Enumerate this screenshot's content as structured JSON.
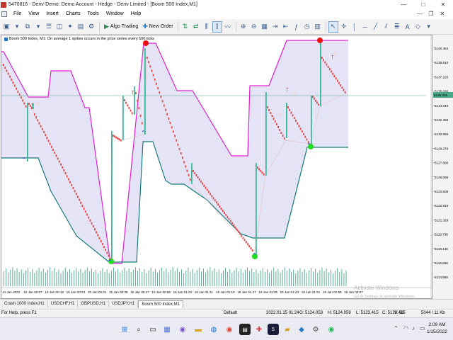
{
  "window": {
    "title": "5470816 - Deriv-Demo: Demo Account - Hedge - Deriv Limited - [Boom 500 Index,M1]",
    "controls": [
      "—",
      "□",
      "✕"
    ]
  },
  "menu": {
    "items": [
      "File",
      "View",
      "Insert",
      "Charts",
      "Tools",
      "Window",
      "Help"
    ],
    "mdi_controls": [
      "—",
      "❐",
      "✕"
    ]
  },
  "toolbar": {
    "algo_trading_label": "Algo Trading",
    "new_order_label": "New Order"
  },
  "chart": {
    "info_text": "Boom 500 Index, M1:  On average 1 spikes occurs in the price series every 500 ticks",
    "current_price_label": "5135.036",
    "price_labels": [
      "5140.484",
      "5138.810",
      "5137.220",
      "5135.036",
      "5134.048",
      "5132.458",
      "5130.868",
      "5129.278",
      "5127.690",
      "5126.098",
      "5124.508",
      "5122.918",
      "5121.328",
      "5119.738",
      "5118.148",
      "5116.558",
      "5114.968"
    ],
    "time_labels": [
      "14 Jan 2022",
      "15 Jan 00:07",
      "15 Jan 00:15",
      "15 Jan 00:23",
      "15 Jan 00:31",
      "15 Jan 00:39",
      "15 Jan 00:47",
      "15 Jan 00:55",
      "15 Jan 01:03",
      "15 Jan 01:11",
      "15 Jan 01:19",
      "15 Jan 01:27",
      "15 Jan 01:35",
      "15 Jan 01:43",
      "15 Jan 01:51",
      "15 Jan 01:59",
      "15 Jan 02:07"
    ],
    "colors": {
      "up_candle": "#3cb89a",
      "down_candle": "#e04848",
      "upper_band": "#e020d0",
      "lower_band": "#157a7a",
      "channel_fill": "#e4e4f6",
      "price_line": "#4aa88a"
    }
  },
  "chart_data": {
    "type": "candlestick",
    "symbol": "Boom 500 Index",
    "timeframe": "M1",
    "x_range": [
      "14 Jan 2022",
      "15 Jan 02:07"
    ],
    "y_range": [
      5114.968,
      5140.484
    ],
    "current_price": 5135.036,
    "spikes_up_at": [
      "15 Jan 00:07",
      "15 Jan 00:39",
      "15 Jan 00:47",
      "15 Jan 01:27",
      "15 Jan 01:35",
      "15 Jan 01:51"
    ],
    "markers": {
      "green_dots": [
        "15 Jan 00:39",
        "15 Jan 01:27",
        "15 Jan 01:51"
      ],
      "red_dots": [
        "15 Jan 00:47",
        "15 Jan 01:59"
      ],
      "red_arrows": 4,
      "blue_arrows": 4
    }
  },
  "tabs": [
    {
      "label": "Crash 1000 Index,H1",
      "active": false
    },
    {
      "label": "USDCHF,H1",
      "active": false
    },
    {
      "label": "GBPUSD,H1",
      "active": false
    },
    {
      "label": "USDJPY,H1",
      "active": false
    },
    {
      "label": "Boom 500 Index,M1",
      "active": true
    }
  ],
  "status": {
    "help": "For Help, press F1",
    "profile": "Default",
    "time": "2022.01.15 01:24",
    "open": "O: 5124.059",
    "high": "H: 5124.059",
    "low": "L: 5123.415",
    "close": "C: 5123.415",
    "volume": "V: 59",
    "traffic": "5044 / 11 Kb"
  },
  "watermark": {
    "line1": "Activate Windows",
    "line2": "Go to Settings to activate Windows."
  },
  "taskbar": {
    "time": "2:09 AM",
    "date": "1/15/2022"
  }
}
